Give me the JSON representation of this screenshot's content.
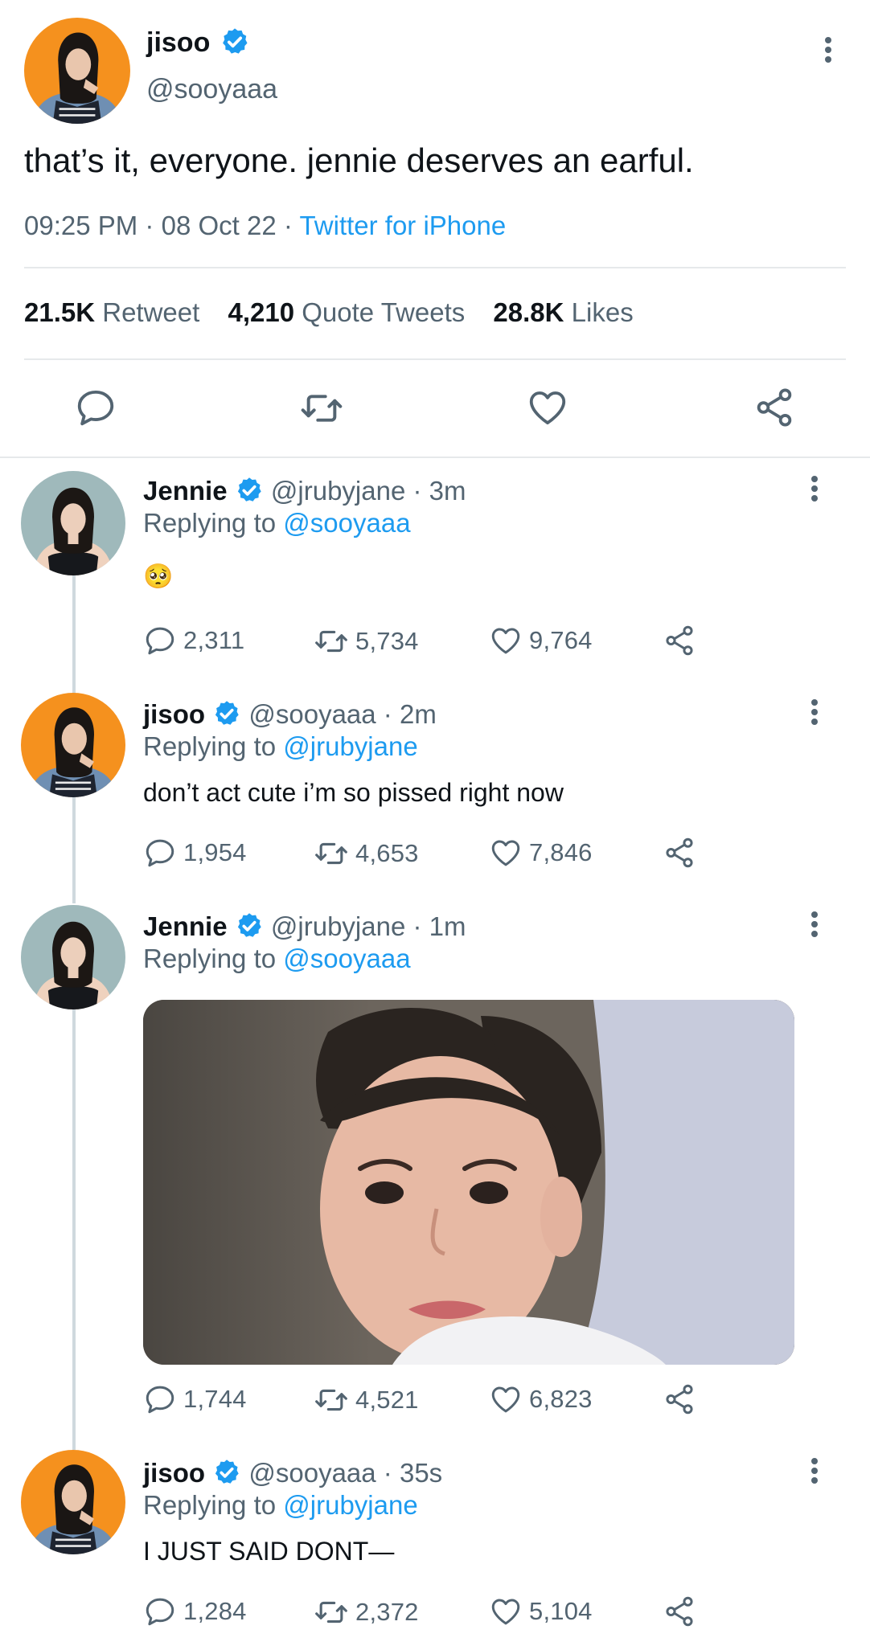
{
  "colors": {
    "accent": "#1d9bf0",
    "muted": "#536471",
    "text": "#0f1419",
    "divider": "#e6e9eb"
  },
  "main_tweet": {
    "author_name": "jisoo",
    "handle": "@sooyaaa",
    "text": "that’s it, everyone. jennie deserves an earful.",
    "time": "09:25 PM",
    "date": "08 Oct 22",
    "source": "Twitter for iPhone",
    "stats": {
      "retweets": "21.5K",
      "retweets_label": "Retweet",
      "quotes": "4,210",
      "quotes_label": "Quote Tweets",
      "likes": "28.8K",
      "likes_label": "Likes"
    }
  },
  "replies": [
    {
      "author_name": "Jennie",
      "handle": "@jrubyjane",
      "age": "3m",
      "replying_prefix": "Replying to",
      "replying_to": "@sooyaaa",
      "text": "🥺",
      "reply_count": "2,311",
      "retweet_count": "5,734",
      "like_count": "9,764"
    },
    {
      "author_name": "jisoo",
      "handle": "@sooyaaa",
      "age": "2m",
      "replying_prefix": "Replying to",
      "replying_to": "@jrubyjane",
      "text": "don’t act cute i’m so pissed right now",
      "reply_count": "1,954",
      "retweet_count": "4,653",
      "like_count": "7,846"
    },
    {
      "author_name": "Jennie",
      "handle": "@jrubyjane",
      "age": "1m",
      "replying_prefix": "Replying to",
      "replying_to": "@sooyaaa",
      "text": "",
      "reply_count": "1,744",
      "retweet_count": "4,521",
      "like_count": "6,823"
    },
    {
      "author_name": "jisoo",
      "handle": "@sooyaaa",
      "age": "35s",
      "replying_prefix": "Replying to",
      "replying_to": "@jrubyjane",
      "text": "I JUST SAID DONT—",
      "reply_count": "1,284",
      "retweet_count": "2,372",
      "like_count": "5,104"
    }
  ],
  "separator": "·",
  "icons": {
    "reply": "reply-icon",
    "retweet": "retweet-icon",
    "like": "heart-icon",
    "share": "share-icon",
    "more": "more-icon",
    "verified": "verified-badge-icon"
  }
}
